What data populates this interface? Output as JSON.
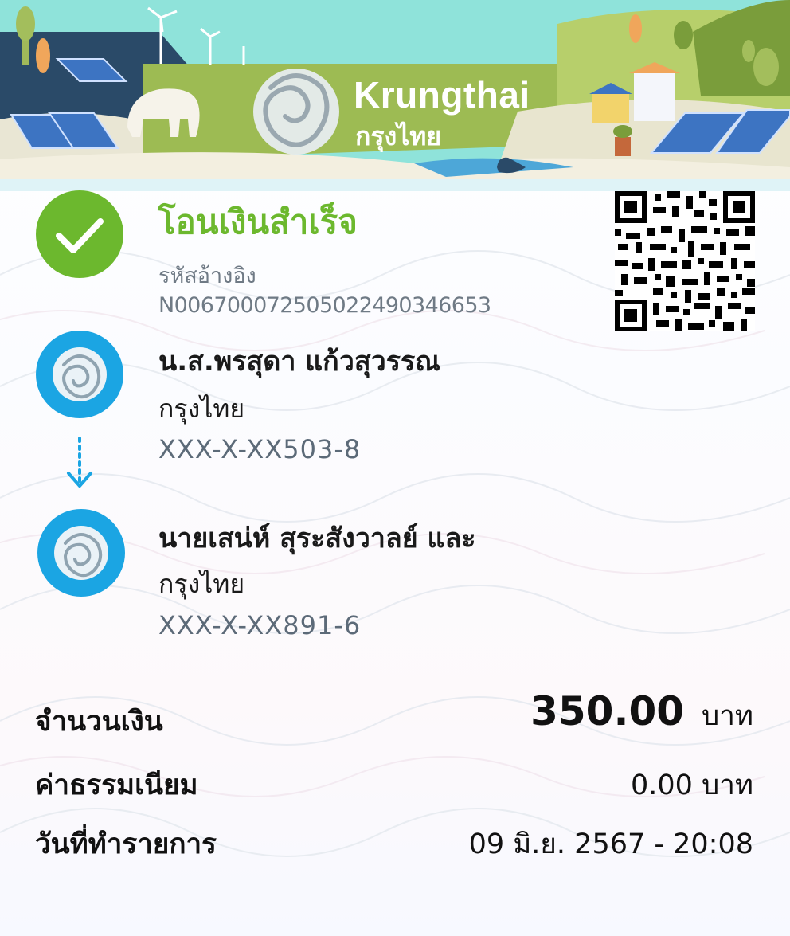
{
  "brand": {
    "name_en": "Krungthai",
    "name_th": "กรุงไทย"
  },
  "status": {
    "title": "โอนเงินสำเร็จ",
    "ref_label": "รหัสอ้างอิง",
    "ref_value": "N006700072505022490346653",
    "icon": "check-circle-icon",
    "color": "#6cb82e"
  },
  "sender": {
    "name": "น.ส.พรสุดา แก้วสุวรรณ",
    "bank": "กรุงไทย",
    "account": "XXX-X-XX503-8"
  },
  "receiver": {
    "name": "นายเสน่ห์ สุระสังวาลย์ และ",
    "bank": "กรุงไทย",
    "account": "XXX-X-XX891-6"
  },
  "details": {
    "amount_label": "จำนวนเงิน",
    "amount_value": "350.00",
    "amount_unit": "บาท",
    "fee_label": "ค่าธรรมเนียม",
    "fee_value": "0.00 บาท",
    "date_label": "วันที่ทำรายการ",
    "date_value": "09 มิ.ย. 2567 - 20:08"
  },
  "colors": {
    "accent_blue": "#1ba5e3",
    "success_green": "#6cb82e",
    "muted_text": "#6f7a85"
  }
}
